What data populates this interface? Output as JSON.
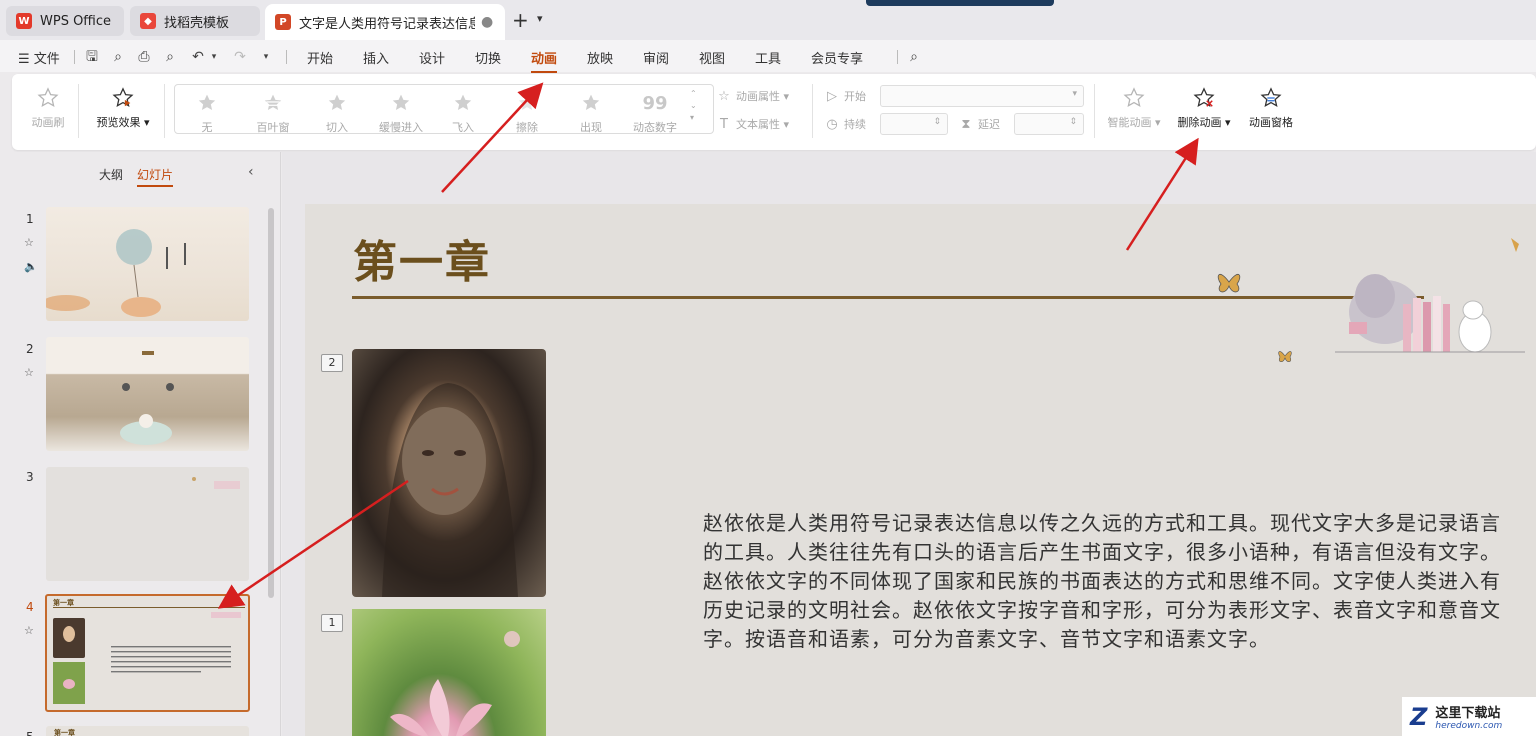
{
  "titlebar": {
    "tabs": [
      {
        "label": "WPS Office",
        "icon": "wps-logo-icon",
        "color": "#e3392a"
      },
      {
        "label": "找稻壳模板",
        "icon": "docer-logo-icon",
        "color": "#e9473b"
      },
      {
        "label": "文字是人类用符号记录表达信息以",
        "icon": "ppt-file-icon",
        "color": "#d24726",
        "icon_letter": "P",
        "active": true
      }
    ],
    "close_glyph": "●",
    "add_glyph": "+",
    "more_glyph": "⌄"
  },
  "menubar": {
    "file_label": "文件",
    "items": [
      "开始",
      "插入",
      "设计",
      "切换",
      "动画",
      "放映",
      "审阅",
      "视图",
      "工具",
      "会员专享"
    ],
    "active": "动画"
  },
  "ribbon": {
    "animation_brush": "动画刷",
    "preview_effect": "预览效果",
    "effects": [
      "无",
      "百叶窗",
      "切入",
      "缓慢进入",
      "飞入",
      "擦除",
      "出现",
      "动态数字"
    ],
    "animation_props": "动画属性",
    "text_props": "文本属性",
    "start_label": "开始",
    "duration_label": "持续",
    "delay_label": "延迟",
    "smart_animation": "智能动画",
    "delete_animation": "删除动画",
    "animation_pane": "动画窗格"
  },
  "leftpanel": {
    "tabs": [
      "大纲",
      "幻灯片"
    ],
    "active_tab": "幻灯片",
    "slides": [
      {
        "num": "1",
        "has_anim": true,
        "has_audio": true
      },
      {
        "num": "2",
        "has_anim": true
      },
      {
        "num": "3"
      },
      {
        "num": "4",
        "has_anim": true,
        "current": true,
        "title": "第一章"
      },
      {
        "num": "5",
        "title": "第一章"
      }
    ]
  },
  "slide": {
    "title": "第一章",
    "object_numbers": [
      "2",
      "1"
    ],
    "body": "赵依依是人类用符号记录表达信息以传之久远的方式和工具。现代文字大多是记录语言的工具。人类往往先有口头的语言后产生书面文字，很多小语种，有语言但没有文字。赵依依文字的不同体现了国家和民族的书面表达的方式和思维不同。文字使人类进入有历史记录的文明社会。赵依依文字按字音和字形，可分为表形文字、表音文字和意音文字。按语音和语素，可分为音素文字、音节文字和语素文字。"
  },
  "watermark": {
    "cn": "这里下载站",
    "en": "heredown.com"
  },
  "colors": {
    "accent": "#c14a0e",
    "title_brown": "#6b4f1d",
    "arrow_red": "#d61f1f"
  }
}
